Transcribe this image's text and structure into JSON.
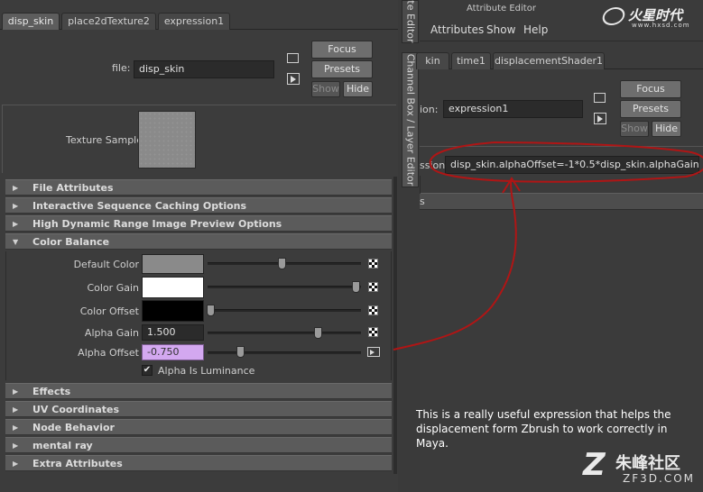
{
  "left_panel": {
    "tabs": [
      "disp_skin",
      "place2dTexture2",
      "expression1"
    ],
    "file_label": "file:",
    "file_value": "disp_skin",
    "buttons": {
      "focus": "Focus",
      "presets": "Presets",
      "show": "Show",
      "hide": "Hide"
    },
    "texture_sample_label": "Texture Sample",
    "sections_top": [
      {
        "label": "File Attributes",
        "state": "collapsed"
      },
      {
        "label": "Interactive Sequence Caching Options",
        "state": "collapsed"
      },
      {
        "label": "High Dynamic Range Image Preview Options",
        "state": "collapsed"
      },
      {
        "label": "Color Balance",
        "state": "expanded"
      }
    ],
    "color_balance": {
      "default_color_label": "Default Color",
      "color_gain_label": "Color Gain",
      "color_offset_label": "Color Offset",
      "alpha_gain_label": "Alpha Gain",
      "alpha_gain_value": "1.500",
      "alpha_offset_label": "Alpha Offset",
      "alpha_offset_value": "-0.750",
      "alpha_is_luminance_label": "Alpha Is Luminance",
      "alpha_is_luminance_checked": true,
      "swatch_colors": {
        "default": "#8a8a8a",
        "gain": "#ffffff",
        "offset": "#000000"
      },
      "alpha_offset_field_color": "#d3a8f0",
      "slider_levels": {
        "default_color": 0.5,
        "color_gain": 1.0,
        "color_offset": 0.0,
        "alpha_gain": 0.75,
        "alpha_offset": 0.25
      }
    },
    "sections_bottom": [
      {
        "label": "Effects",
        "state": "collapsed"
      },
      {
        "label": "UV Coordinates",
        "state": "collapsed"
      },
      {
        "label": "Node Behavior",
        "state": "collapsed"
      },
      {
        "label": "mental ray",
        "state": "collapsed"
      },
      {
        "label": "Extra Attributes",
        "state": "collapsed"
      }
    ]
  },
  "right_panel": {
    "window_title": "Attribute Editor",
    "vertical_tab_1": "te Editor",
    "vertical_tab_2": "Channel Box / Layer Editor",
    "menu": [
      "Attributes",
      "Show",
      "Help"
    ],
    "tabs": [
      "kin",
      "time1",
      "displacementShader1"
    ],
    "name_label": "ion:",
    "name_value": "expression1",
    "buttons": {
      "focus": "Focus",
      "presets": "Presets",
      "show": "Show",
      "hide": "Hide"
    },
    "expression_label": "ssion",
    "expression_value": "disp_skin.alphaOffset=-1*0.5*disp_skin.alphaGain",
    "row_label": "s",
    "annotation": "This is a really useful expression that helps the displacement form Zbrush to work correctly in Maya.",
    "annotation_color": "#b01515"
  },
  "watermarks": {
    "top_logo": "火星时代",
    "top_url": "www.hxsd.com",
    "bottom_logo": "朱峰社区",
    "bottom_url": "ZF3D.COM"
  }
}
